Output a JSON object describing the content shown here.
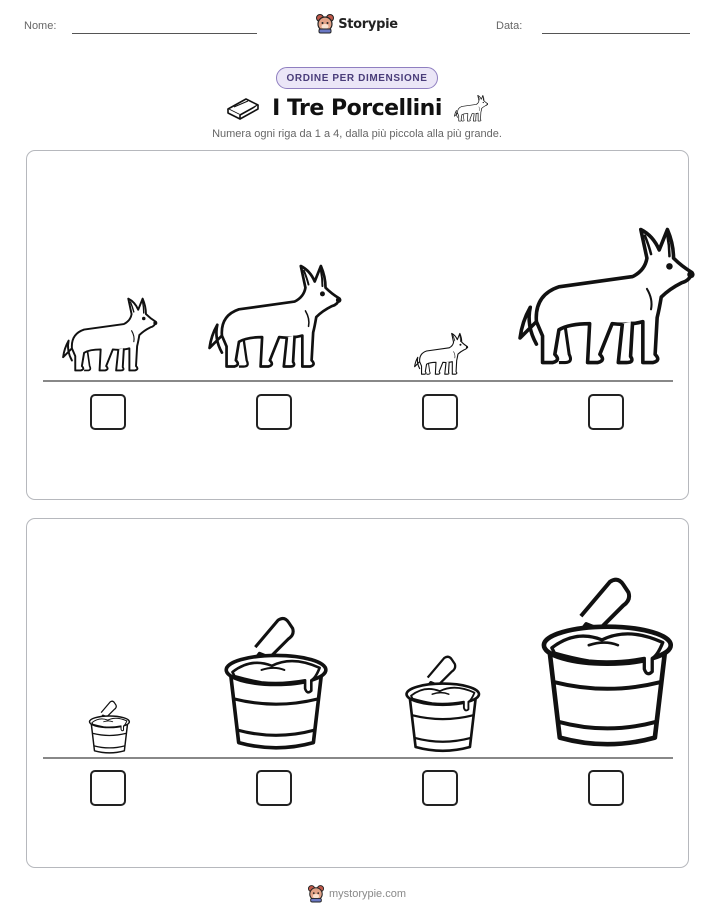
{
  "header": {
    "name_label": "Nome:",
    "date_label": "Data:",
    "brand_name": "Storypie",
    "brand_icon": "bear-mascot-icon"
  },
  "badge": "ORDINE PER DIMENSIONE",
  "title": "I Tre Porcellini",
  "title_icons": [
    "brick-icon",
    "wolf-icon"
  ],
  "instructions": "Numera ogni riga da 1 a 4, dalla più piccola alla più grande.",
  "rows": [
    {
      "subject": "wolf",
      "items": [
        {
          "icon": "wolf-icon",
          "relative_size": 0.52,
          "answer": ""
        },
        {
          "icon": "wolf-icon",
          "relative_size": 0.73,
          "answer": ""
        },
        {
          "icon": "wolf-icon",
          "relative_size": 0.3,
          "answer": ""
        },
        {
          "icon": "wolf-icon",
          "relative_size": 1.0,
          "answer": ""
        }
      ]
    },
    {
      "subject": "mortar-bucket",
      "items": [
        {
          "icon": "mortar-bucket-icon",
          "relative_size": 0.3,
          "answer": ""
        },
        {
          "icon": "mortar-bucket-icon",
          "relative_size": 0.78,
          "answer": ""
        },
        {
          "icon": "mortar-bucket-icon",
          "relative_size": 0.57,
          "answer": ""
        },
        {
          "icon": "mortar-bucket-icon",
          "relative_size": 1.0,
          "answer": ""
        }
      ]
    }
  ],
  "footer": {
    "text": "mystorypie.com",
    "icon": "bear-mascot-icon"
  }
}
